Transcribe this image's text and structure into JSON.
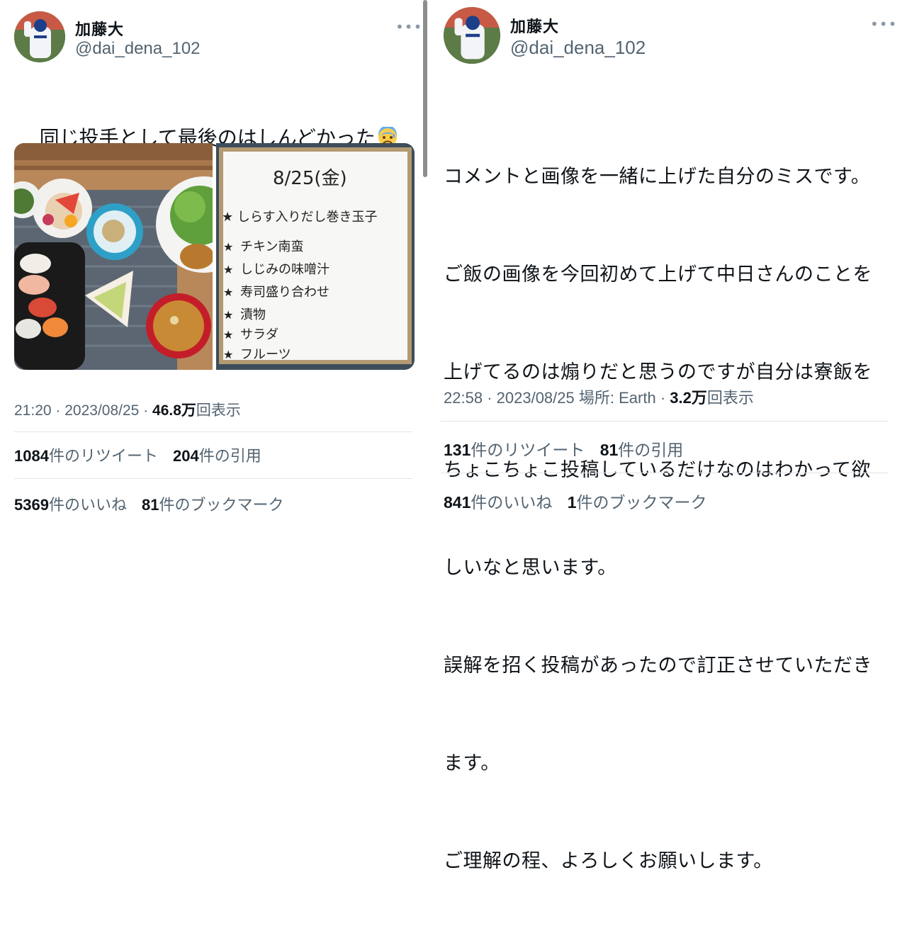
{
  "left": {
    "display_name": "加藤大",
    "handle": "@dai_dena_102",
    "more_label": "•••",
    "text": "同じ投手として最後のはしんどかった",
    "emoji_name": "anxious-face-with-sweat-icon",
    "whiteboard": {
      "date": "8/25(金)",
      "items": [
        "しらす入りだし巻き玉子",
        "チキン南蛮",
        "しじみの味噌汁",
        "寿司盛り合わせ",
        "漬物",
        "サラダ",
        "フルーツ"
      ]
    },
    "meta": {
      "time": "21:20",
      "sep1": "·",
      "date": "2023/08/25",
      "sep2": "·",
      "views_num": "46.8万",
      "views_label": "回表示"
    },
    "stats": {
      "retweets_num": "1084",
      "retweets_label": "件のリツイート",
      "quotes_num": "204",
      "quotes_label": "件の引用",
      "likes_num": "5369",
      "likes_label": "件のいいね",
      "bookmarks_num": "81",
      "bookmarks_label": "件のブックマーク"
    }
  },
  "right": {
    "display_name": "加藤大",
    "handle": "@dai_dena_102",
    "more_label": "•••",
    "text_lines": [
      "コメントと画像を一緒に上げた自分のミスです。",
      "ご飯の画像を今回初めて上げて中日さんのことを",
      "上げてるのは煽りだと思うのですが自分は寮飯を",
      "ちょこちょこ投稿しているだけなのはわかって欲",
      "しいなと思います。",
      "誤解を招く投稿があったので訂正させていただき",
      "ます。",
      "ご理解の程、よろしくお願いします。"
    ],
    "meta": {
      "time": "22:58",
      "sep1": "·",
      "date": "2023/08/25",
      "location": "場所: Earth",
      "sep2": "·",
      "views_num": "3.2万",
      "views_label": "回表示"
    },
    "stats": {
      "retweets_num": "131",
      "retweets_label": "件のリツイート",
      "quotes_num": "81",
      "quotes_label": "件の引用",
      "likes_num": "841",
      "likes_label": "件のいいね",
      "bookmarks_num": "1",
      "bookmarks_label": "件のブックマーク"
    }
  },
  "colors": {
    "text": "#0f1419",
    "secondary": "#536471",
    "divider": "#e1e4e8"
  }
}
